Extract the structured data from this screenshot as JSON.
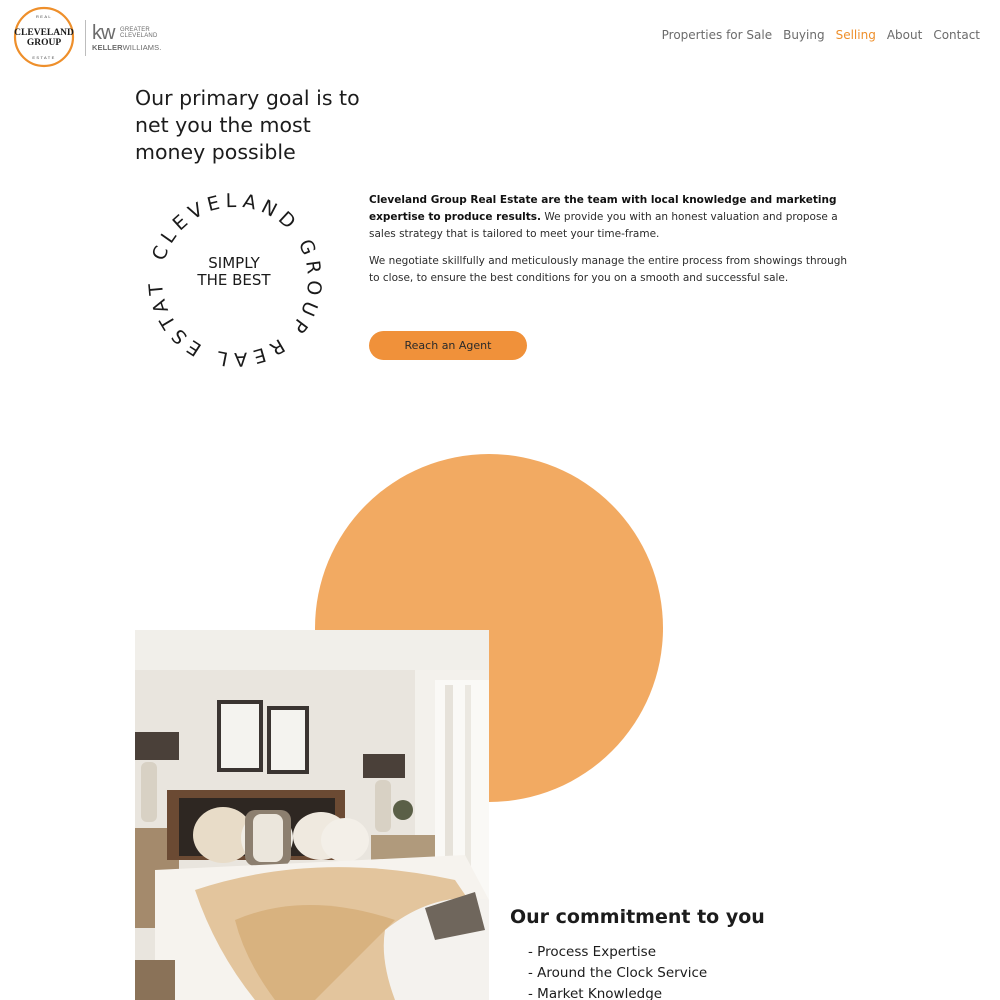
{
  "header": {
    "logo": {
      "ring_top": "REAL",
      "line1": "CLEVELAND",
      "line2": "GROUP",
      "ring_bottom": "ESTATE"
    },
    "kw_logo": {
      "mark": "kw",
      "greater": "GREATER",
      "cleveland": "CLEVELAND",
      "keller": "KELLER",
      "williams": "WILLIAMS."
    },
    "nav": [
      {
        "label": "Properties for Sale"
      },
      {
        "label": "Buying"
      },
      {
        "label": "Selling"
      },
      {
        "label": "About"
      },
      {
        "label": "Contact"
      }
    ],
    "active_nav": "Selling"
  },
  "intro": {
    "headline": "Our primary goal is to net you the most money possible",
    "badge": {
      "ring_text": "CLEVELAND GROUP REAL ESTATE",
      "center_line1": "SIMPLY",
      "center_line2": "THE BEST"
    },
    "para1_bold": "Cleveland Group Real Estate are the team with local knowledge and marketing expertise to produce results.",
    "para1_rest": " We provide  you with an honest valuation and propose a sales strategy that is tailored to meet your time-frame.",
    "para2": "We negotiate skillfully and meticulously manage the entire process from showings through to close, to ensure the best conditions for you on a smooth and successful sale.",
    "cta_label": "Reach an Agent"
  },
  "commitment": {
    "title": "Our commitment to you",
    "items": [
      "Process Expertise",
      "Around the Clock Service",
      "Market Knowledge"
    ]
  },
  "colors": {
    "accent": "#f0913a",
    "disc": "#f2aa62",
    "nav_text": "#6b6b6b",
    "active_nav": "#ee8f2b"
  }
}
